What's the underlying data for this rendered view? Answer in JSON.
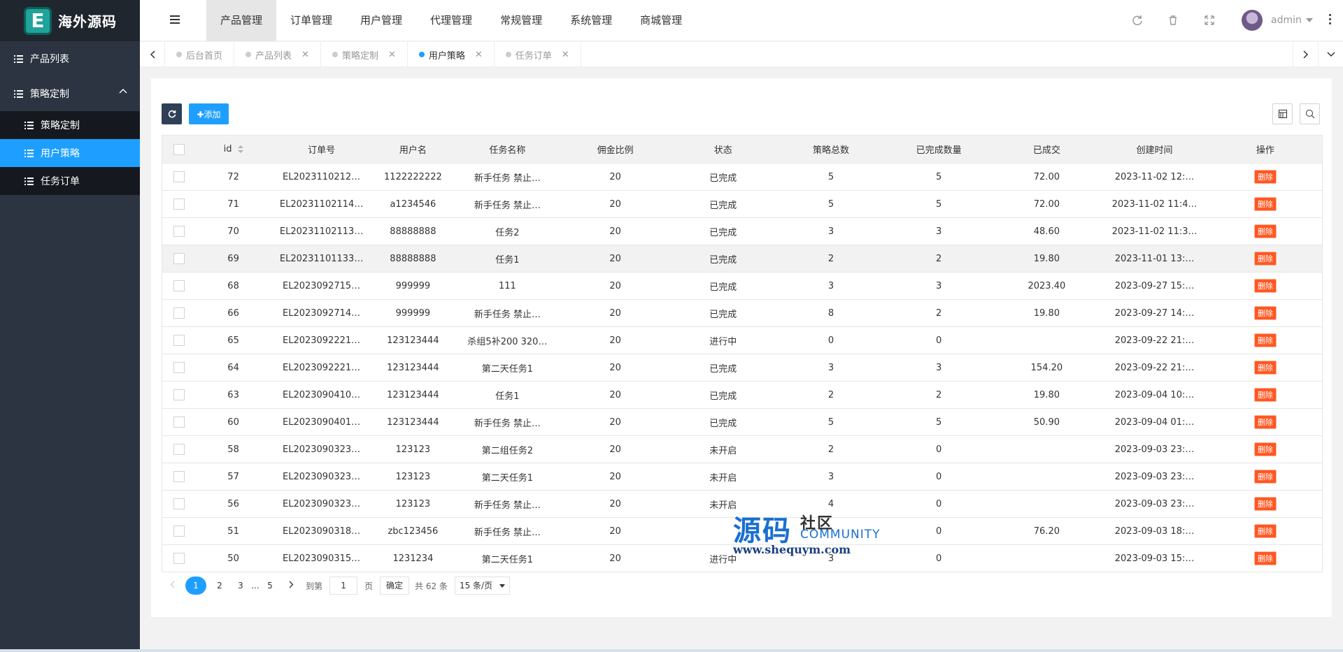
{
  "brand": {
    "logo_letter": "E",
    "name": "海外源码",
    "accent": "#1fa39a"
  },
  "sidebar": {
    "items": [
      {
        "label": "产品列表",
        "icon": "list-icon"
      },
      {
        "label": "策略定制",
        "icon": "list-icon",
        "expanded": true
      }
    ],
    "sub_items": [
      {
        "label": "策略定制",
        "active": false
      },
      {
        "label": "用户策略",
        "active": true
      },
      {
        "label": "任务订单",
        "active": false
      }
    ]
  },
  "header": {
    "menu": [
      "产品管理",
      "订单管理",
      "用户管理",
      "代理管理",
      "常规管理",
      "系统管理",
      "商城管理"
    ],
    "active_menu": "产品管理",
    "user": "admin"
  },
  "tabs": [
    {
      "label": "后台首页",
      "active": false,
      "closable": false
    },
    {
      "label": "产品列表",
      "active": false,
      "closable": true
    },
    {
      "label": "策略定制",
      "active": false,
      "closable": true
    },
    {
      "label": "用户策略",
      "active": true,
      "closable": true
    },
    {
      "label": "任务订单",
      "active": false,
      "closable": true
    }
  ],
  "toolbar": {
    "add_label": "✚添加"
  },
  "table": {
    "columns": [
      "id",
      "订单号",
      "用户名",
      "任务名称",
      "佣金比例",
      "状态",
      "策略总数",
      "已完成数量",
      "已成交",
      "创建时间",
      "操作"
    ],
    "rows": [
      [
        "72",
        "EL2023110212…",
        "1122222222",
        "新手任务 禁止…",
        "20",
        "已完成",
        "5",
        "5",
        "72.00",
        "2023-11-02 12:…"
      ],
      [
        "71",
        "EL20231102114…",
        "a1234546",
        "新手任务 禁止…",
        "20",
        "已完成",
        "5",
        "5",
        "72.00",
        "2023-11-02 11:4…"
      ],
      [
        "70",
        "EL20231102113…",
        "88888888",
        "任务2",
        "20",
        "已完成",
        "3",
        "3",
        "48.60",
        "2023-11-02 11:3…"
      ],
      [
        "69",
        "EL20231101133…",
        "88888888",
        "任务1",
        "20",
        "已完成",
        "2",
        "2",
        "19.80",
        "2023-11-01 13:…"
      ],
      [
        "68",
        "EL2023092715…",
        "999999",
        "111",
        "20",
        "已完成",
        "3",
        "3",
        "2023.40",
        "2023-09-27 15:…"
      ],
      [
        "66",
        "EL2023092714…",
        "999999",
        "新手任务 禁止…",
        "20",
        "已完成",
        "8",
        "2",
        "19.80",
        "2023-09-27 14:…"
      ],
      [
        "65",
        "EL2023092221…",
        "123123444",
        "杀组5补200 320…",
        "20",
        "进行中",
        "0",
        "0",
        "",
        "2023-09-22 21:…"
      ],
      [
        "64",
        "EL2023092221…",
        "123123444",
        "第二天任务1",
        "20",
        "已完成",
        "3",
        "3",
        "154.20",
        "2023-09-22 21:…"
      ],
      [
        "63",
        "EL2023090410…",
        "123123444",
        "任务1",
        "20",
        "已完成",
        "2",
        "2",
        "19.80",
        "2023-09-04 10:…"
      ],
      [
        "60",
        "EL2023090401…",
        "123123444",
        "新手任务 禁止…",
        "20",
        "已完成",
        "5",
        "5",
        "50.90",
        "2023-09-04 01:…"
      ],
      [
        "58",
        "EL2023090323…",
        "123123",
        "第二组任务2",
        "20",
        "未开启",
        "2",
        "0",
        "",
        "2023-09-03 23:…"
      ],
      [
        "57",
        "EL2023090323…",
        "123123",
        "第二天任务1",
        "20",
        "未开启",
        "3",
        "0",
        "",
        "2023-09-03 23:…"
      ],
      [
        "56",
        "EL2023090323…",
        "123123",
        "新手任务 禁止…",
        "20",
        "未开启",
        "4",
        "0",
        "",
        "2023-09-03 23:…"
      ],
      [
        "51",
        "EL2023090318…",
        "zbc123456",
        "新手任务 禁止…",
        "20",
        "",
        "",
        "0",
        "76.20",
        "2023-09-03 18:…"
      ],
      [
        "50",
        "EL2023090315…",
        "1231234",
        "第二天任务1",
        "20",
        "进行中",
        "3",
        "0",
        "",
        "2023-09-03 15:…"
      ]
    ],
    "delete_label": "删除",
    "highlight_row": 3
  },
  "pagination": {
    "pages": [
      "1",
      "2",
      "3",
      "…",
      "5"
    ],
    "current": "1",
    "goto_label": "到第",
    "goto_value": "1",
    "page_unit": "页",
    "confirm_label": "确定",
    "total_label": "共 62 条",
    "page_size": "15 条/页"
  },
  "watermark": {
    "big": "源码",
    "side": "社区",
    "community": "COMMUNITY",
    "url": "www.shequym.com"
  }
}
